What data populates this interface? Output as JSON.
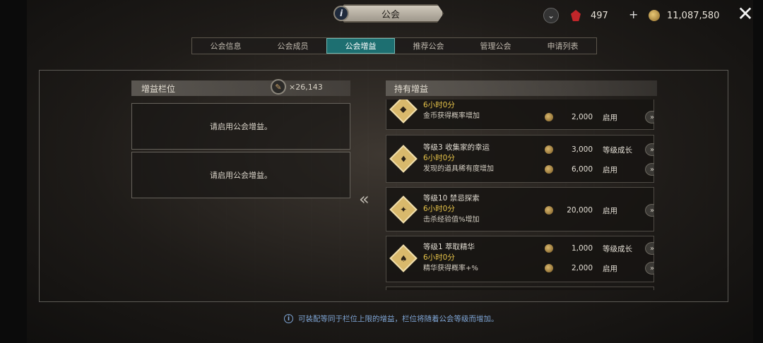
{
  "window": {
    "title": "公会"
  },
  "currencies": {
    "ruby": "497",
    "gold": "11,087,580"
  },
  "tabs": [
    {
      "label": "公会信息"
    },
    {
      "label": "公会成员"
    },
    {
      "label": "公会增益",
      "active": true
    },
    {
      "label": "推荐公会"
    },
    {
      "label": "管理公会"
    },
    {
      "label": "申请列表"
    }
  ],
  "slots": {
    "header": "增益栏位",
    "cost": "26,143",
    "cost_prefix": "×",
    "empty_text": [
      "请启用公会增益。",
      "请启用公会增益。"
    ]
  },
  "held": {
    "header": "持有增益",
    "buffs": [
      {
        "name": "",
        "time": "6小时0分",
        "desc": "金币获得概率增加",
        "costs": [
          {
            "value": "2,000",
            "action": "启用"
          }
        ]
      },
      {
        "name": "等级3  收集家的幸运",
        "time": "6小时0分",
        "desc": "发现的道具稀有度增加",
        "costs": [
          {
            "value": "3,000",
            "action": "等级成长"
          },
          {
            "value": "6,000",
            "action": "启用"
          }
        ]
      },
      {
        "name": "等级10  禁忌探索",
        "time": "6小时0分",
        "desc": "击杀经验值%增加",
        "costs": [
          {
            "value": "20,000",
            "action": "启用"
          }
        ]
      },
      {
        "name": "等级1  萃取精华",
        "time": "6小时0分",
        "desc": "精华获得概率+%",
        "costs": [
          {
            "value": "1,000",
            "action": "等级成长"
          },
          {
            "value": "2,000",
            "action": "启用"
          }
        ]
      }
    ]
  },
  "footer": {
    "note": "可装配等同于栏位上限的增益，栏位将随着公会等级而增加。"
  },
  "colors": {
    "accent_tab": "#1d6f71",
    "time_text": "#e7c44a",
    "note_text": "#7fa6d6"
  }
}
